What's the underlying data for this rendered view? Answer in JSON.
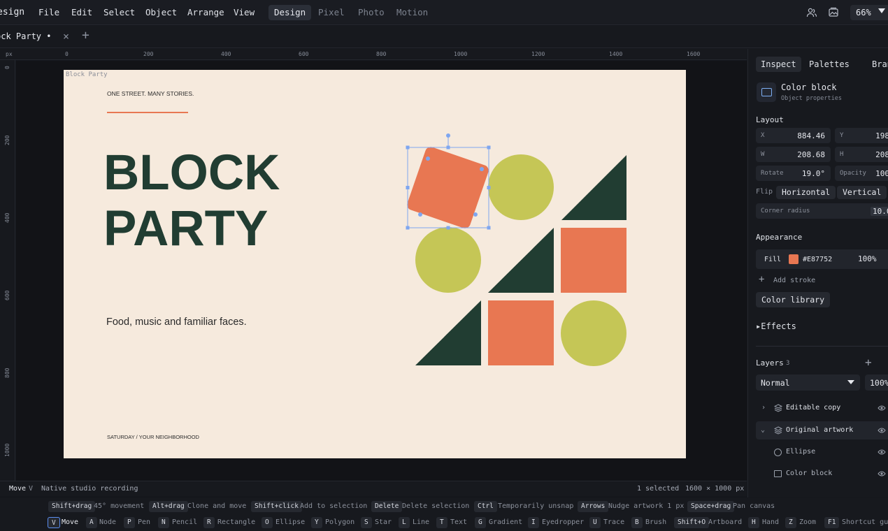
{
  "app": {
    "name": "esign",
    "menu": [
      "File",
      "Edit",
      "Select",
      "Object",
      "Arrange",
      "View"
    ],
    "modes": [
      "Design",
      "Pixel",
      "Photo",
      "Motion"
    ],
    "active_mode": "Design",
    "zoom": "66%",
    "icons": [
      "people-icon",
      "image-stack-icon",
      "chevron-down-icon"
    ]
  },
  "document": {
    "tab_title": "ock Party •"
  },
  "rulers": {
    "unit": "px",
    "top_labels": [
      "0",
      "200",
      "400",
      "600",
      "800",
      "1000",
      "1200",
      "1400",
      "1600"
    ],
    "left_labels": [
      "0",
      "200",
      "400",
      "600",
      "800",
      "1000"
    ]
  },
  "artboard": {
    "label": "Block Party",
    "tagline": "ONE STREET. MANY STORIES.",
    "headline_1": "BLOCK",
    "headline_2": "PARTY",
    "subline": "Food, music and familiar faces.",
    "footer": "SATURDAY / YOUR NEIGHBORHOOD",
    "colors": {
      "background": "#F6EADD",
      "green": "#213D32",
      "orange": "#E87752",
      "lime": "#C5C656"
    }
  },
  "status": {
    "tool": "Move",
    "tool_key": "V",
    "message": "Native studio recording",
    "selection": "1 selected",
    "size": "1600 × 1000 px"
  },
  "shortcut_hints": [
    {
      "key": "Shift+drag",
      "desc": "45° movement"
    },
    {
      "key": "Alt+drag",
      "desc": "Clone and move"
    },
    {
      "key": "Shift+click",
      "desc": "Add to selection"
    },
    {
      "key": "Delete",
      "desc": "Delete selection"
    },
    {
      "key": "Ctrl",
      "desc": "Temporarily unsnap"
    },
    {
      "key": "Arrows",
      "desc": "Nudge artwork 1 px"
    },
    {
      "key": "Space+drag",
      "desc": "Pan canvas"
    }
  ],
  "tools": [
    {
      "key": "V",
      "name": "Move"
    },
    {
      "key": "A",
      "name": "Node"
    },
    {
      "key": "P",
      "name": "Pen"
    },
    {
      "key": "N",
      "name": "Pencil"
    },
    {
      "key": "R",
      "name": "Rectangle"
    },
    {
      "key": "O",
      "name": "Ellipse"
    },
    {
      "key": "Y",
      "name": "Polygon"
    },
    {
      "key": "S",
      "name": "Star"
    },
    {
      "key": "L",
      "name": "Line"
    },
    {
      "key": "T",
      "name": "Text"
    },
    {
      "key": "G",
      "name": "Gradient"
    },
    {
      "key": "I",
      "name": "Eyedropper"
    },
    {
      "key": "U",
      "name": "Trace"
    },
    {
      "key": "B",
      "name": "Brush"
    },
    {
      "key": "Shift+O",
      "name": "Artboard"
    },
    {
      "key": "H",
      "name": "Hand"
    },
    {
      "key": "Z",
      "name": "Zoom"
    },
    {
      "key": "F1",
      "name": "Shortcut gui"
    }
  ],
  "panel": {
    "tabs": [
      "Inspect",
      "Palettes",
      "Brand"
    ],
    "object_title": "Color block",
    "object_sub": "Object properties",
    "layout_label": "Layout",
    "x": {
      "label": "X",
      "value": "884.46"
    },
    "y": {
      "label": "Y",
      "value": "198"
    },
    "w": {
      "label": "W",
      "value": "208.68"
    },
    "h": {
      "label": "H",
      "value": "208"
    },
    "rotate": {
      "label": "Rotate",
      "value": "19.0°"
    },
    "opacity": {
      "label": "Opacity",
      "value": "100"
    },
    "flip_label": "Flip",
    "flip_h": "Horizontal",
    "flip_v": "Vertical",
    "corner": {
      "label": "Corner radius",
      "value": "10.0"
    },
    "appearance_label": "Appearance",
    "fill": {
      "label": "Fill",
      "hex": "#E87752",
      "opacity": "100%",
      "color": "#E87752"
    },
    "add_stroke": "Add stroke",
    "color_library": "Color library",
    "effects": "▸Effects",
    "layers_label": "Layers",
    "layers_count": "3",
    "blend": "Normal",
    "layer_opacity": "100%",
    "layers": [
      {
        "name": "Editable copy",
        "icon": "layers-icon",
        "expander": "›"
      },
      {
        "name": "Original artwork",
        "icon": "layers-icon",
        "expander": "⌄"
      },
      {
        "name": "Ellipse",
        "icon": "ellipse-icon"
      },
      {
        "name": "Color block",
        "icon": "rectangle-icon"
      }
    ]
  }
}
